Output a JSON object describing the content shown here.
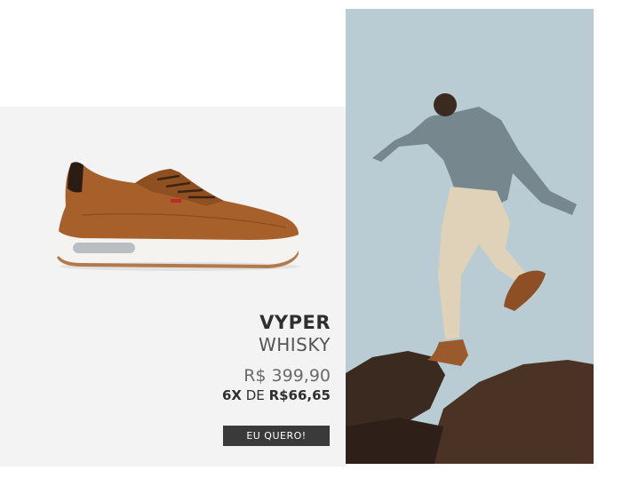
{
  "product": {
    "name": "VYPER",
    "color": "WHISKY",
    "price": "R$ 399,90",
    "installments": {
      "count": "6X",
      "connector": "DE",
      "amount": "R$66,65"
    }
  },
  "cta": {
    "label": "EU QUERO!"
  },
  "images": {
    "shoe": "brown-leather-sneaker-icon",
    "lifestyle": "man-jumping-rocks-photo"
  },
  "colors": {
    "panel_bg": "#f3f3f3",
    "button_bg": "#3a3a3a",
    "leather": "#a8602a",
    "sky": "#b9ccd4"
  }
}
